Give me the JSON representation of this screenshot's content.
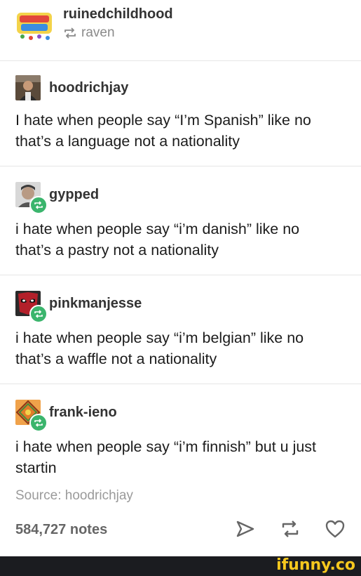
{
  "header": {
    "blog_name": "ruinedchildhood",
    "reblogged_from": "raven"
  },
  "posts": [
    {
      "username": "hoodrichjay",
      "text_line1": "I hate when people say “I’m Spanish” like no",
      "text_line2": "that’s a language not a nationality"
    },
    {
      "username": "gypped",
      "text_line1": "i hate when people say “i’m danish” like no",
      "text_line2": "that’s a pastry not a nationality"
    },
    {
      "username": "pinkmanjesse",
      "text_line1": "i hate when people say “i’m belgian” like no",
      "text_line2": "that’s a waffle not a nationality"
    },
    {
      "username": "frank-ieno",
      "text_line1": "i hate when people say “i’m finnish” but u just",
      "text_line2": "startin"
    }
  ],
  "source": "Source: hoodrichjay",
  "notes": "584,727 notes",
  "watermark": "ifunny.co",
  "colors": {
    "reblog_green": "#3bb56d",
    "watermark_yellow": "#f6c81e",
    "footer_bg": "#1b1c20"
  }
}
